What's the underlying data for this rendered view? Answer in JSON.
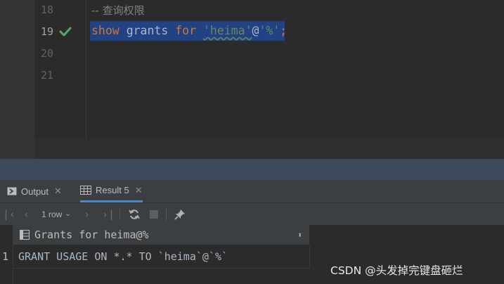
{
  "editor": {
    "lines": [
      {
        "num": "18",
        "comment": "-- 查询权限"
      },
      {
        "num": "19"
      },
      {
        "num": "20"
      },
      {
        "num": "21"
      }
    ],
    "code": {
      "kw1": "show",
      "word": "grants",
      "kw2": "for",
      "str1": "'heima'",
      "at": "@",
      "str2": "'%'",
      "semi": ";"
    }
  },
  "tabs": [
    {
      "label": "Output",
      "icon": "console-icon",
      "active": false
    },
    {
      "label": "Result 5",
      "icon": "table-icon",
      "active": true
    }
  ],
  "toolbar": {
    "rows_label": "1 row",
    "buttons": [
      "first-page-icon",
      "prev-page-icon",
      "next-page-icon",
      "last-page-icon",
      "refresh-icon",
      "stop-icon",
      "pin-icon"
    ]
  },
  "result": {
    "column_header": "Grants for heima@%",
    "rows": [
      {
        "num": "1",
        "value": "GRANT USAGE ON *.* TO `heima`@`%`"
      }
    ]
  },
  "watermark": "CSDN @头发掉完键盘砸烂",
  "colors": {
    "editor_bg": "#2b2b2b",
    "selection": "#214283",
    "keyword": "#cc7832",
    "string": "#6a8759",
    "check": "#59a869"
  }
}
